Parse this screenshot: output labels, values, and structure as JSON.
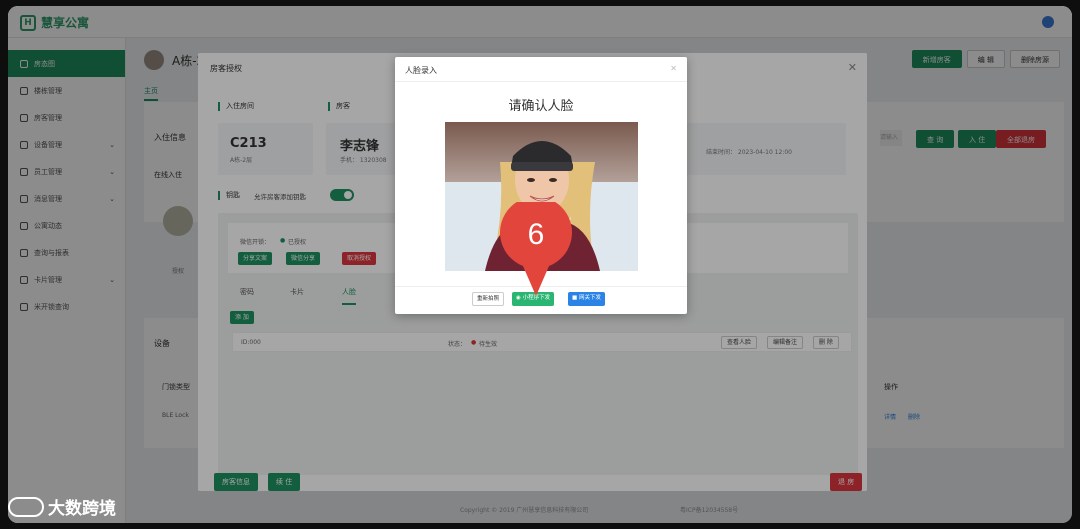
{
  "app": {
    "title": "慧享公寓",
    "logo_glyph": "H"
  },
  "sidebar": {
    "items": [
      {
        "label": "房态图",
        "icon": "home-icon"
      },
      {
        "label": "楼栋管理",
        "icon": "building-icon"
      },
      {
        "label": "房客管理",
        "icon": "user-icon"
      },
      {
        "label": "设备管理",
        "icon": "device-icon"
      },
      {
        "label": "员工管理",
        "icon": "staff-icon"
      },
      {
        "label": "消息管理",
        "icon": "bell-icon"
      },
      {
        "label": "公寓动态",
        "icon": "compass-icon"
      },
      {
        "label": "查询与报表",
        "icon": "report-icon"
      },
      {
        "label": "卡片管理",
        "icon": "card-icon"
      },
      {
        "label": "米开锁查询",
        "icon": "lock-icon"
      }
    ]
  },
  "room": {
    "title": "A栋-2层 C213",
    "tab": "主页",
    "buttons": [
      "新增房客",
      "编 辑",
      "删除房源"
    ]
  },
  "dialog": {
    "title": "房客授权",
    "checkin_room_label": "入住房间",
    "tenant_label": "房客",
    "room_code": "C213",
    "room_floor": "A栋-2层",
    "tenant_name": "李志锋",
    "tenant_phone": "手机：  1320308",
    "end_time": "结束时间：  2023-04-10 12:00",
    "key_label": "钥匙",
    "key_option": "允许房客添加钥匙",
    "wechat_unlock": "微信开锁：",
    "authorized": "已授权",
    "btn_share_text": "分享文案",
    "btn_wechat_share": "微信分享",
    "btn_cancel_auth": "取消授权",
    "tabs": [
      "密码",
      "卡片",
      "人脸"
    ],
    "add_btn": "添 加",
    "row_id": "ID:000",
    "row_status": "状态：",
    "row_status_value": "待生效",
    "row_btn_view": "查看人脸",
    "row_btn_note": "编辑备注",
    "row_btn_delete": "删 除",
    "btn_tenant_info": "房客信息",
    "btn_renew": "续 住",
    "btn_checkout": "退 房"
  },
  "background": {
    "checkin_info": "入住信息",
    "online_checkin": "在线入住",
    "auth_label": "授权",
    "device": "设备",
    "lock_type": "门锁类型",
    "ble_lock": "BLE Lock",
    "operation": "操作",
    "op_detail": "详情",
    "op_delete": "删除",
    "query_btn": "查 询",
    "checkin_btn": "入 住",
    "checkout_all_btn": "全部退房",
    "search_placeholder": "请输入",
    "copyright": "Copyright © 2019 广州慧享信息科技有限公司",
    "icp": "粤ICP备12034558号"
  },
  "face_dialog": {
    "title": "人脸录入",
    "subtitle": "请确认人脸",
    "btn_retake": "重新拍照",
    "btn_mini": "小程序下发",
    "btn_gateway": "网关下发"
  },
  "marker": {
    "number": "6"
  },
  "watermark": {
    "text": "大数跨境"
  },
  "colors": {
    "primary": "#1e9160",
    "danger": "#d9363e",
    "blue": "#2b83e6"
  }
}
